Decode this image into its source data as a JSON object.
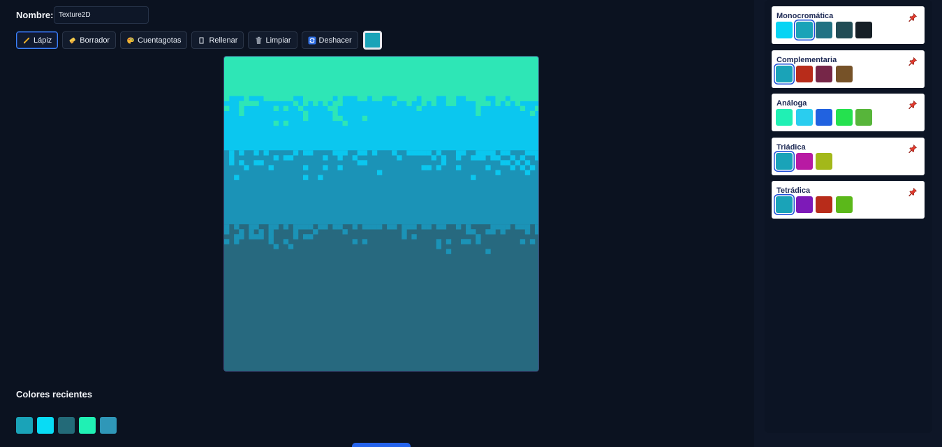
{
  "editor": {
    "name_label": "Nombre:",
    "name_value": "Texture2D"
  },
  "toolbar": {
    "pencil_label": "Lápiz",
    "eraser_label": "Borrador",
    "eyedropper_label": "Cuentagotas",
    "fill_label": "Rellenar",
    "clear_label": "Limpiar",
    "undo_label": "Deshacer",
    "active_tool": "pencil",
    "current_color": "#1aa3b8",
    "icons": {
      "pencil": "pencil-icon",
      "eraser": "eraser-icon",
      "eyedropper": "palette-icon",
      "fill": "fill-icon",
      "clear": "trash-icon",
      "undo": "undo-icon"
    }
  },
  "canvas": {
    "grid_columns": 64,
    "grid_rows": 64,
    "layer_colors": [
      "#2ee6b6",
      "#0bc7ef",
      "#1b93b7",
      "#27697f"
    ]
  },
  "recent": {
    "title": "Colores recientes",
    "colors": [
      "#1aa3b8",
      "#08dcf5",
      "#236a78",
      "#20f0b4",
      "#2f97b8"
    ]
  },
  "harmonies": [
    {
      "title": "Monocromática",
      "colors": [
        "#07d4f4",
        "#1aa3b8",
        "#227283",
        "#214c55",
        "#161f26"
      ],
      "selected": 1
    },
    {
      "title": "Complementaria",
      "colors": [
        "#1aa3b8",
        "#b82c1a",
        "#762648",
        "#765228"
      ],
      "selected": 0
    },
    {
      "title": "Análoga",
      "colors": [
        "#20f0b4",
        "#2acdef",
        "#2162e0",
        "#25e14f",
        "#57b53a"
      ],
      "selected": -1
    },
    {
      "title": "Triádica",
      "colors": [
        "#1aa3b8",
        "#b81aa3",
        "#a3b81a"
      ],
      "selected": 0
    },
    {
      "title": "Tetrádica",
      "colors": [
        "#1aa3b8",
        "#7d1ab8",
        "#b82c1a",
        "#5bb81a"
      ],
      "selected": 0
    }
  ],
  "colors": {
    "accent": "#3b82f6",
    "background": "#0b1220",
    "pin": "#e23b2e"
  }
}
